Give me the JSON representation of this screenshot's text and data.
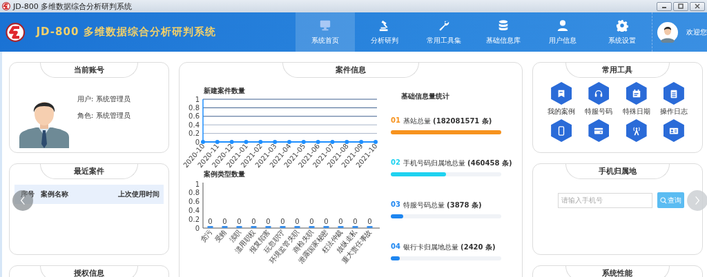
{
  "window": {
    "title": "JD-800 多维数据综合分析研判系统"
  },
  "header": {
    "app_title": "JD-800 多维数据综合分析研判系统",
    "nav": [
      {
        "kind": "monitor",
        "label": "系统首页",
        "selected": true
      },
      {
        "kind": "gavel",
        "label": "分析研判",
        "selected": false
      },
      {
        "kind": "wrench",
        "label": "常用工具集",
        "selected": false
      },
      {
        "kind": "database",
        "label": "基础信息库",
        "selected": false
      },
      {
        "kind": "user",
        "label": "用户信息",
        "selected": false
      },
      {
        "kind": "gear",
        "label": "系统设置",
        "selected": false
      }
    ],
    "welcome": "欢迎您"
  },
  "account": {
    "title": "当前账号",
    "user": "用户: 系统管理员",
    "role": "角色: 系统管理员"
  },
  "recent_cases": {
    "title": "最近案件",
    "columns": [
      "序号",
      "案例名称",
      "上次使用时间"
    ]
  },
  "license": {
    "title": "授权信息"
  },
  "case_info": {
    "title": "案件信息",
    "new_cases": {
      "chart_data": {
        "type": "line",
        "title": "新建案件数量",
        "categories": [
          "2020-10",
          "2020-11",
          "2020-12",
          "2021-01",
          "2021-02",
          "2021-03",
          "2021-04",
          "2021-05",
          "2021-06",
          "2021-07",
          "2021-08",
          "2021-09",
          "2021-10"
        ],
        "series": [
          {
            "color": "#1e8fff",
            "marker": true,
            "values": [
              0,
              0,
              0,
              0,
              0,
              0,
              0,
              0,
              0,
              0,
              0,
              0,
              0
            ]
          }
        ],
        "ylim": [
          0,
          1
        ],
        "yticks": [
          0,
          0.2,
          0.4,
          0.6,
          0.8,
          1
        ],
        "grid": true
      }
    },
    "case_types": {
      "chart_data": {
        "type": "bar",
        "title": "案例类型数量",
        "categories": [
          "贪污",
          "受贿",
          "渎职",
          "滥用职权",
          "报复陷害",
          "玩忽职守",
          "环境监管失职",
          "商检失职",
          "泄露国家秘密",
          "枉法仲裁",
          "放纵走私",
          "重大责任事故"
        ],
        "values": [
          0,
          0,
          0,
          0,
          0,
          0,
          0,
          0,
          0,
          0,
          0,
          0
        ],
        "ylim": [
          0,
          1
        ],
        "yticks": [
          0,
          0.2,
          0.4,
          0.6,
          0.8,
          1
        ],
        "data_labels": true
      }
    },
    "stats": {
      "title": "基础信息量统计",
      "items": [
        {
          "index": "01",
          "text": "基站总量 **(182081571 条)**",
          "level": 1,
          "color": "#f7931e"
        },
        {
          "index": "02",
          "text": "手机号码归属地总量 **(460458 条)**",
          "level": 0.5,
          "color": "#1ed2f0"
        },
        {
          "index": "03",
          "text": "特服号码总量 **(3878 条)**",
          "level": 0.11,
          "color": "#1e86f0"
        },
        {
          "index": "04",
          "text": "银行卡归属地总量 **(2420 条)**",
          "level": 0.08,
          "color": "#1e86f0"
        }
      ]
    }
  },
  "tools": {
    "title": "常用工具",
    "items": [
      {
        "kind": "bookmark",
        "label": "我的案例"
      },
      {
        "kind": "headset",
        "label": "特服号码"
      },
      {
        "kind": "calendar",
        "label": "特殊日期"
      },
      {
        "kind": "clipboard",
        "label": "操作日志"
      },
      {
        "kind": "phone"
      },
      {
        "kind": "card"
      },
      {
        "kind": "tower"
      },
      {
        "kind": "idcard"
      }
    ]
  },
  "phone_lookup": {
    "title": "手机归属地",
    "placeholder": "请输入手机号",
    "button": "查询"
  },
  "performance": {
    "title": "系统性能"
  }
}
